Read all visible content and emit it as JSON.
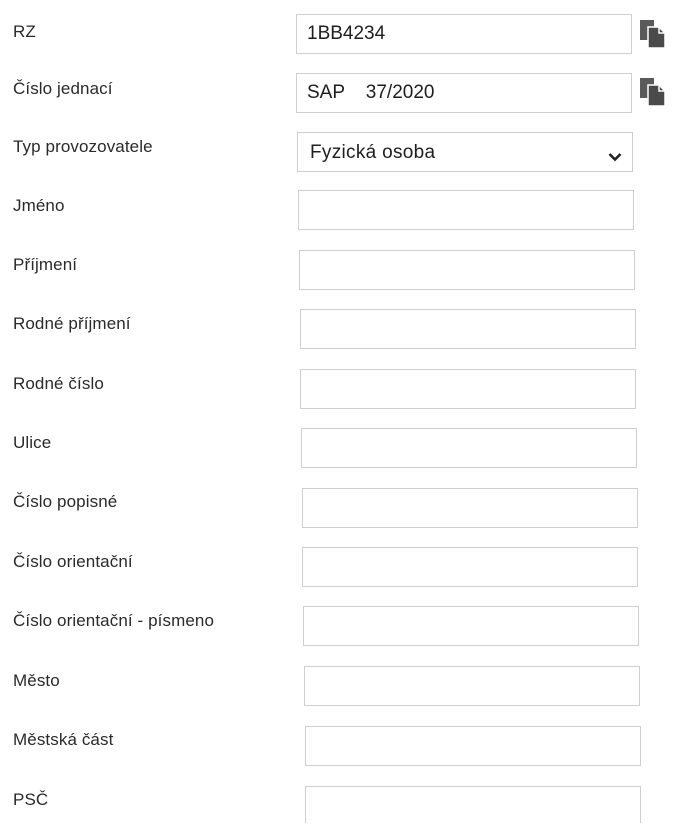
{
  "form": {
    "rz": {
      "label": "RZ",
      "value": "1BB4234",
      "copy_icon": "copy-icon"
    },
    "cislo_jednaci": {
      "label": "Číslo jednací",
      "value": "SAP    37/2020",
      "copy_icon": "copy-icon"
    },
    "typ_provozovatele": {
      "label": "Typ provozovatele",
      "selected": "Fyzická osoba",
      "icon": "chevron-down-icon"
    },
    "jmeno": {
      "label": "Jméno",
      "value": ""
    },
    "prijmeni": {
      "label": "Příjmení",
      "value": ""
    },
    "rodne_prijmeni": {
      "label": "Rodné příjmení",
      "value": ""
    },
    "rodne_cislo": {
      "label": "Rodné číslo",
      "value": ""
    },
    "ulice": {
      "label": "Ulice",
      "value": ""
    },
    "cislo_popisne": {
      "label": "Číslo popisné",
      "value": ""
    },
    "cislo_orientacni": {
      "label": "Číslo orientační",
      "value": ""
    },
    "cislo_orientacni_pismeno": {
      "label": "Číslo orientační - písmeno",
      "value": ""
    },
    "mesto": {
      "label": "Město",
      "value": ""
    },
    "mestska_cast": {
      "label": "Městská část",
      "value": ""
    },
    "psc": {
      "label": "PSČ",
      "value": ""
    }
  }
}
